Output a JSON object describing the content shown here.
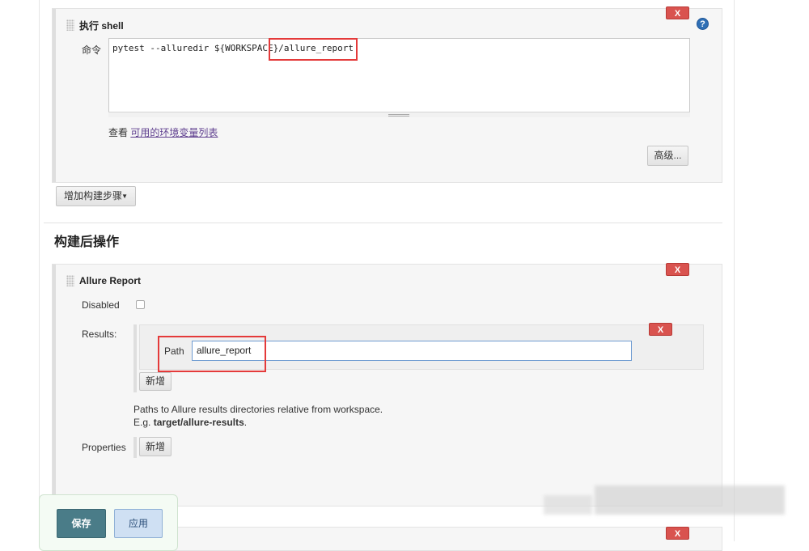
{
  "build_step": {
    "title": "执行 shell",
    "command_label": "命令",
    "command_value": "pytest --alluredir ${WORKSPACE}/allure_report",
    "env_prefix": "查看",
    "env_link": "可用的环境变量列表",
    "advanced_label": "高级...",
    "delete_label": "X",
    "help_label": "?"
  },
  "add_build_step_label": "增加构建步骤",
  "post_build": {
    "heading": "构建后操作",
    "allure": {
      "title": "Allure Report",
      "delete_label": "X",
      "disabled_label": "Disabled",
      "results_label": "Results:",
      "path_label": "Path",
      "path_value": "allure_report",
      "path_delete_label": "X",
      "add_label": "新增",
      "hint_line1": "Paths to Allure results directories relative from workspace.",
      "hint_line2_prefix": "E.g.",
      "hint_line2_bold": "target/allure-results",
      "hint_line2_suffix": ".",
      "properties_label": "Properties",
      "properties_add_label": "新增"
    }
  },
  "footer": {
    "save_label": "保存",
    "apply_label": "应用",
    "next_delete_label": "X"
  },
  "colors": {
    "delete_red": "#d9534f",
    "highlight_red": "#e43a3a",
    "save_teal": "#4a7c88",
    "apply_blue": "#cfe0f3"
  }
}
